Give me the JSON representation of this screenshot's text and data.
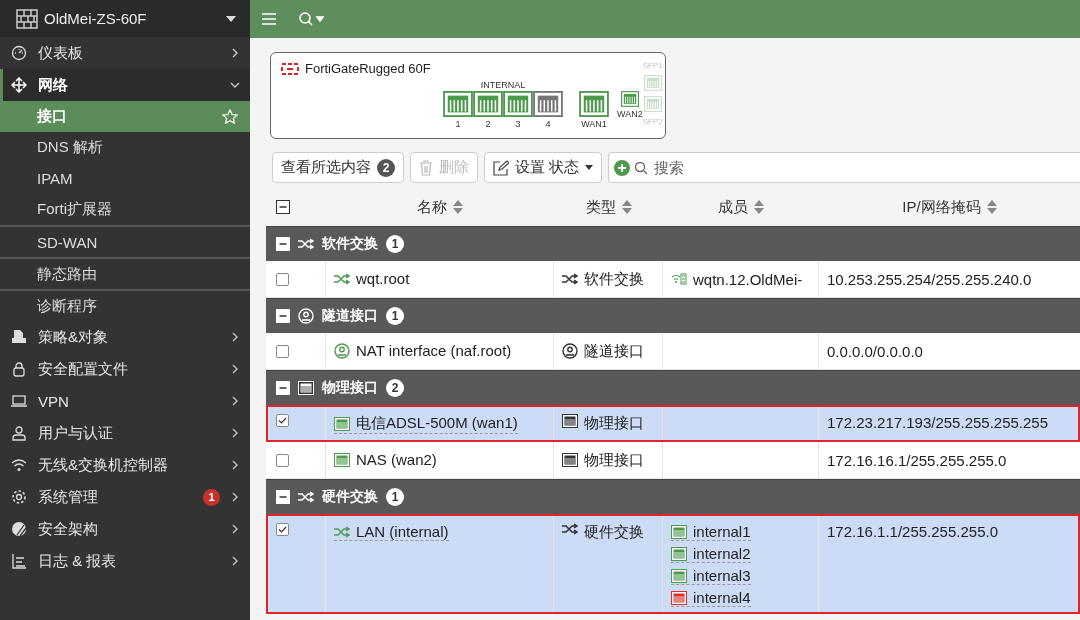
{
  "sidebar": {
    "device": "OldMei-ZS-60F",
    "items": [
      {
        "label": "仪表板",
        "expanded": false
      },
      {
        "label": "网络",
        "expanded": true,
        "children": [
          {
            "label": "接口",
            "selected": true
          },
          {
            "label": "DNS 解析",
            "selected": false
          },
          {
            "label": "IPAM",
            "selected": false
          },
          {
            "label": "Forti扩展器",
            "selected": false
          },
          {
            "label": "SD-WAN",
            "selected": false
          },
          {
            "label": "静态路由",
            "selected": false
          },
          {
            "label": "诊断程序",
            "selected": false
          }
        ]
      },
      {
        "label": "策略&对象",
        "expanded": false
      },
      {
        "label": "安全配置文件",
        "expanded": false
      },
      {
        "label": "VPN",
        "expanded": false
      },
      {
        "label": "用户与认证",
        "expanded": false
      },
      {
        "label": "无线&交换机控制器",
        "expanded": false
      },
      {
        "label": "系统管理",
        "expanded": false,
        "badge": "1"
      },
      {
        "label": "安全架构",
        "expanded": false
      },
      {
        "label": "日志 & 报表",
        "expanded": false
      }
    ]
  },
  "device_panel": {
    "model": "FortiGateRugged 60F",
    "group_label": "INTERNAL",
    "ports": [
      {
        "label": "1",
        "link_up": true,
        "kind": "rj45"
      },
      {
        "label": "2",
        "link_up": true,
        "kind": "rj45"
      },
      {
        "label": "3",
        "link_up": true,
        "kind": "rj45"
      },
      {
        "label": "4",
        "link_up": false,
        "kind": "rj45"
      },
      {
        "label": "WAN1",
        "link_up": true,
        "kind": "rj45"
      },
      {
        "label": "WAN2",
        "link_up": true,
        "kind": "small"
      }
    ],
    "sfp_ports": [
      {
        "label": "SFP1",
        "enabled": false
      },
      {
        "label": "SFP2",
        "enabled": false
      }
    ]
  },
  "toolbar": {
    "view_selected": "查看所选内容",
    "selected_count": "2",
    "delete": "删除",
    "delete_disabled": true,
    "set_status": "设置 状态",
    "search_placeholder": "搜索"
  },
  "table": {
    "columns": [
      "名称",
      "类型",
      "成员",
      "IP/网络掩码"
    ],
    "groups": [
      {
        "label": "软件交换",
        "kind": "switch",
        "count": "1",
        "expanded": true,
        "rows": [
          {
            "name": "wqt.root",
            "kind": "switch",
            "type": "软件交换",
            "selected": false,
            "members": [
              {
                "name": "wqtn.12.OldMei-",
                "kind": "wifi",
                "link_up": true
              }
            ],
            "ip": "10.253.255.254/255.255.240.0"
          }
        ]
      },
      {
        "label": "隧道接口",
        "kind": "tunnel",
        "count": "1",
        "expanded": true,
        "rows": [
          {
            "name": "NAT interface (naf.root)",
            "kind": "tunnel",
            "type": "隧道接口",
            "selected": false,
            "members": [],
            "ip": "0.0.0.0/0.0.0.0"
          }
        ]
      },
      {
        "label": "物理接口",
        "kind": "physical",
        "count": "2",
        "expanded": true,
        "rows": [
          {
            "name": "电信ADSL-500M (wan1)",
            "kind": "physical",
            "type": "物理接口",
            "selected": true,
            "members": [],
            "ip": "172.23.217.193/255.255.255.255"
          },
          {
            "name": "NAS (wan2)",
            "kind": "physical",
            "type": "物理接口",
            "selected": false,
            "members": [],
            "ip": "172.16.16.1/255.255.255.0"
          }
        ]
      },
      {
        "label": "硬件交换",
        "kind": "switch",
        "count": "1",
        "expanded": true,
        "rows": [
          {
            "name": "LAN (internal)",
            "kind": "switch",
            "type": "硬件交换",
            "selected": true,
            "members": [
              {
                "name": "internal1",
                "kind": "port",
                "link_up": true
              },
              {
                "name": "internal2",
                "kind": "port",
                "link_up": true
              },
              {
                "name": "internal3",
                "kind": "port",
                "link_up": true
              },
              {
                "name": "internal4",
                "kind": "port",
                "link_up": false
              }
            ],
            "ip": "172.16.1.1/255.255.255.0"
          }
        ]
      }
    ]
  }
}
